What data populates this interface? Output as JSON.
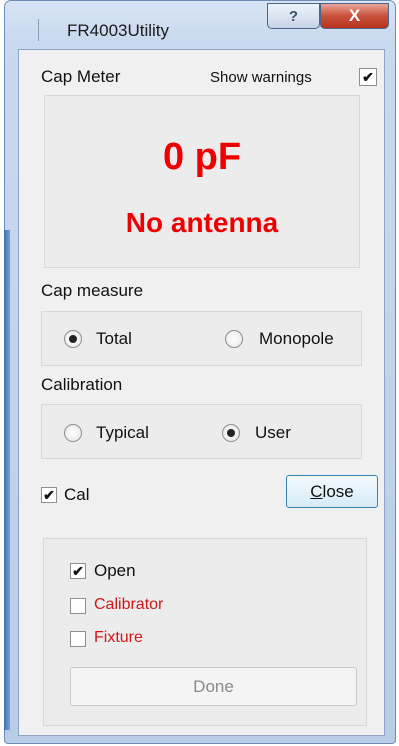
{
  "window": {
    "title": "FR4003Utility",
    "help_glyph": "?",
    "close_glyph": "X"
  },
  "cap_meter": {
    "label": "Cap Meter",
    "show_warnings_label": "Show warnings",
    "show_warnings_checked": true,
    "reading": "0 pF",
    "status": "No antenna",
    "reading_color": "#ee0000"
  },
  "cap_measure": {
    "label": "Cap measure",
    "options": [
      {
        "label": "Total",
        "selected": true
      },
      {
        "label": "Monopole",
        "selected": false
      }
    ]
  },
  "calibration": {
    "label": "Calibration",
    "options": [
      {
        "label": "Typical",
        "selected": false
      },
      {
        "label": "User",
        "selected": true
      }
    ]
  },
  "cal": {
    "label": "Cal",
    "checked": true,
    "close_button": "Close",
    "close_mnemonic": "C",
    "close_rest": "lose"
  },
  "cal_steps": {
    "items": [
      {
        "label": "Open",
        "checked": true,
        "color": "#111111"
      },
      {
        "label": "Calibrator",
        "checked": false,
        "color": "#d01818"
      },
      {
        "label": "Fixture",
        "checked": false,
        "color": "#d01818"
      }
    ],
    "done_button": "Done"
  },
  "check_glyph": "✔"
}
